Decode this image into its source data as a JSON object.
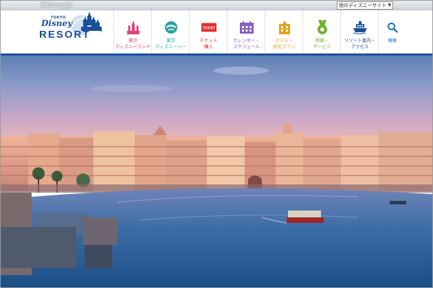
{
  "topbar": {
    "brand": "Disney.jp",
    "site_select": "他のディズニーサイト"
  },
  "logo": {
    "tokyo": "TOKYO",
    "disney": "Disney",
    "resort": "RESORT"
  },
  "nav": {
    "items": [
      {
        "label": "東京\nディズニーランド",
        "color": "#e0407a",
        "icon": "castle-icon"
      },
      {
        "label": "東京\nディズニーシー",
        "color": "#2aa3a0",
        "icon": "globe-icon"
      },
      {
        "label": "チケット\n購入",
        "color": "#e52c2c",
        "icon": "ticket-icon",
        "badge": "TICKET"
      },
      {
        "label": "カレンダー・\nスケジュール",
        "color": "#8a5cc4",
        "icon": "calendar-icon"
      },
      {
        "label": "ホテル・\n宿泊プラン",
        "color": "#e9a21a",
        "icon": "hotel-icon"
      },
      {
        "label": "特典・\nサービス",
        "color": "#6bb22b",
        "icon": "medal-icon"
      },
      {
        "label": "リゾート案内・\nアクセス",
        "color": "#1a4f99",
        "icon": "ship-icon"
      },
      {
        "label": "検索",
        "color": "#1a6fc4",
        "icon": "search-icon"
      }
    ]
  },
  "hero": {
    "scene": "mediterranean-harbor-photo"
  }
}
